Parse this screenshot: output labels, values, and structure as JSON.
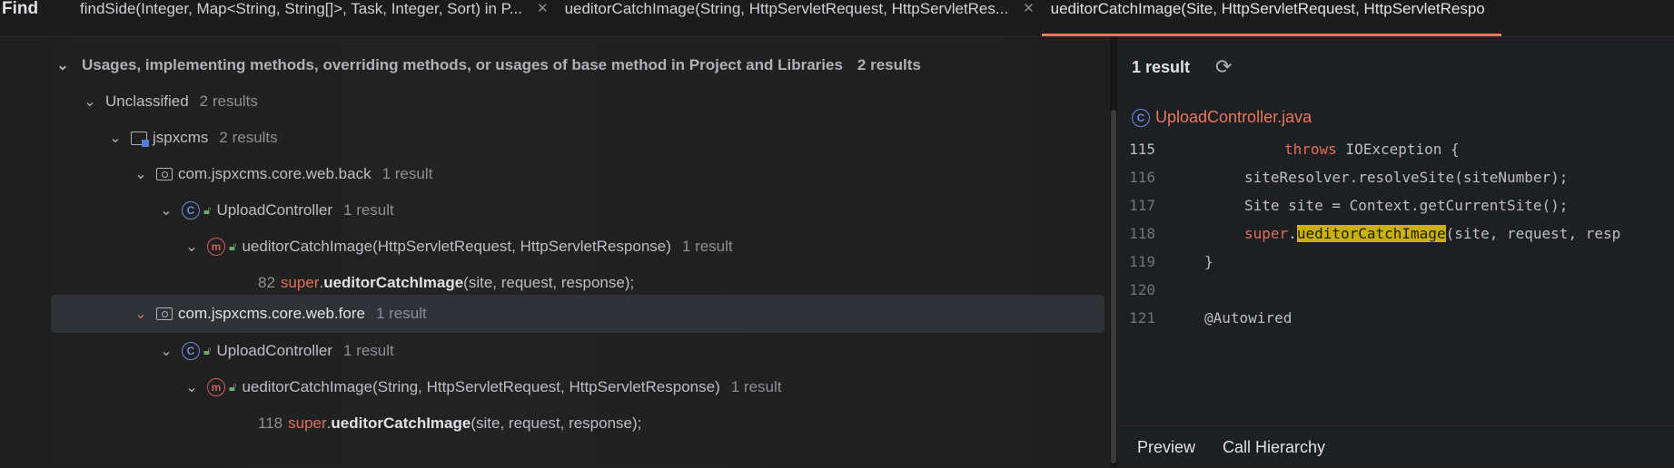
{
  "topbar": {
    "title": "Find",
    "tabs": [
      {
        "label": "findSide(Integer, Map<String, String[]>, Task, Integer, Sort) in P...",
        "active": false
      },
      {
        "label": "ueditorCatchImage(String, HttpServletRequest, HttpServletRes...",
        "active": false
      },
      {
        "label": "ueditorCatchImage(Site, HttpServletRequest, HttpServletRespo",
        "active": true
      }
    ],
    "close_glyph": "✕"
  },
  "leftbar": {
    "icons": [
      "refresh-icon",
      "arrow-up-icon",
      "arrow-down-icon",
      "settings-icon",
      "eye-icon",
      "read-access-icon",
      "write-access-icon",
      "group-by-directory-icon",
      "info-icon",
      "expand-all-icon",
      "collapse-all-icon"
    ]
  },
  "tree": {
    "header": {
      "label": "Usages, implementing methods, overriding methods, or usages of base method in Project and Libraries",
      "count": "2 results"
    },
    "unclassified": {
      "label": "Unclassified",
      "count": "2 results"
    },
    "module": {
      "label": "jspxcms",
      "count": "2 results"
    },
    "pkg_back": {
      "label": "com.jspxcms.core.web.back",
      "count": "1 result"
    },
    "class_back": {
      "label": "UploadController",
      "count": "1 result"
    },
    "method_back": {
      "label": "ueditorCatchImage(HttpServletRequest, HttpServletResponse)",
      "count": "1 result"
    },
    "usage_back": {
      "line": "82",
      "kw": "super",
      "dot": ".",
      "method": "ueditorCatchImage",
      "args": "(site, request, response);"
    },
    "pkg_fore": {
      "label": "com.jspxcms.core.web.fore",
      "count": "1 result"
    },
    "class_fore": {
      "label": "UploadController",
      "count": "1 result"
    },
    "method_fore": {
      "label": "ueditorCatchImage(String, HttpServletRequest, HttpServletResponse)",
      "count": "1 result"
    },
    "usage_fore": {
      "line": "118",
      "kw": "super",
      "dot": ".",
      "method": "ueditorCatchImage",
      "args": "(site, request, response);"
    }
  },
  "preview": {
    "result_count": "1 result",
    "file": "UploadController.java",
    "code": [
      {
        "ln": "115",
        "pre": "",
        "kw": "throws",
        "post": " IOException {"
      },
      {
        "ln": "116",
        "text": "siteResolver.resolveSite(siteNumber);"
      },
      {
        "ln": "117",
        "text": "Site site = Context.getCurrentSite();"
      },
      {
        "ln": "118",
        "kw": "super",
        "dot": ".",
        "hl": "ueditorCatchImage",
        "post": "(site, request, resp"
      },
      {
        "ln": "119",
        "text": "}"
      },
      {
        "ln": "120",
        "text": ""
      },
      {
        "ln": "121",
        "text": "@Autowired"
      }
    ],
    "tabs": [
      "Preview",
      "Call Hierarchy"
    ]
  }
}
